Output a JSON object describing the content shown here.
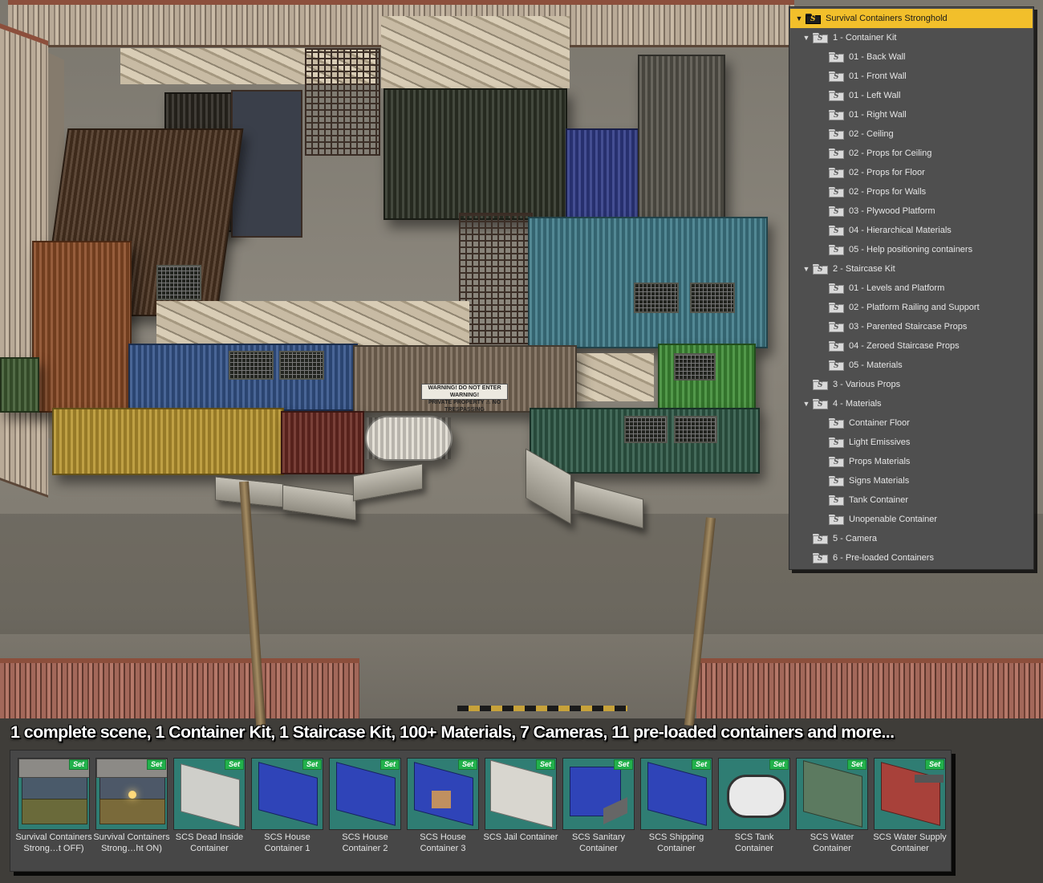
{
  "tree": {
    "root": {
      "label": "Survival Containers Stronghold",
      "expanded": true
    },
    "items": [
      {
        "label": "1 - Container Kit",
        "level": 1,
        "expanded": true
      },
      {
        "label": "01 - Back Wall",
        "level": 2
      },
      {
        "label": "01 - Front Wall",
        "level": 2
      },
      {
        "label": "01 - Left Wall",
        "level": 2
      },
      {
        "label": "01 - Right Wall",
        "level": 2
      },
      {
        "label": "02 - Ceiling",
        "level": 2
      },
      {
        "label": "02 - Props for Ceiling",
        "level": 2
      },
      {
        "label": "02 - Props for Floor",
        "level": 2
      },
      {
        "label": "02 - Props for Walls",
        "level": 2
      },
      {
        "label": "03 - Plywood Platform",
        "level": 2
      },
      {
        "label": "04 - Hierarchical Materials",
        "level": 2
      },
      {
        "label": "05 - Help positioning containers",
        "level": 2
      },
      {
        "label": "2 - Staircase Kit",
        "level": 1,
        "expanded": true
      },
      {
        "label": "01 - Levels and Platform",
        "level": 2
      },
      {
        "label": "02 - Platform Railing and Support",
        "level": 2
      },
      {
        "label": "03 - Parented Staircase Props",
        "level": 2
      },
      {
        "label": "04 - Zeroed Staircase Props",
        "level": 2
      },
      {
        "label": "05 - Materials",
        "level": 2
      },
      {
        "label": "3 - Various Props",
        "level": 1
      },
      {
        "label": "4 - Materials",
        "level": 1,
        "expanded": true
      },
      {
        "label": "Container Floor",
        "level": 2
      },
      {
        "label": "Light Emissives",
        "level": 2
      },
      {
        "label": "Props Materials",
        "level": 2
      },
      {
        "label": "Signs Materials",
        "level": 2
      },
      {
        "label": "Tank Container",
        "level": 2
      },
      {
        "label": "Unopenable Container",
        "level": 2
      },
      {
        "label": "5 - Camera",
        "level": 1
      },
      {
        "label": "6 - Pre-loaded Containers",
        "level": 1
      }
    ]
  },
  "caption": "1 complete scene, 1 Container Kit, 1 Staircase Kit, 100+ Materials, 7 Cameras, 11 pre-loaded containers and more...",
  "scene_sign": {
    "line1": "WARNING!   DO NOT ENTER   WARNING!",
    "line2": "PRIVATE PROPERTY ⚠ NO TRESPASSING"
  },
  "thumbnails": [
    {
      "label": "Survival Containers Strong…t OFF)",
      "badge": "Set",
      "kind": "scene"
    },
    {
      "label": "Survival Containers Strong…ht ON)",
      "badge": "Set",
      "kind": "scene-lit"
    },
    {
      "label": "SCS Dead Inside Container",
      "badge": "Set",
      "kind": "white"
    },
    {
      "label": "SCS House Container 1",
      "badge": "Set",
      "kind": "blue"
    },
    {
      "label": "SCS House Container 2",
      "badge": "Set",
      "kind": "blue"
    },
    {
      "label": "SCS House Container 3",
      "badge": "Set",
      "kind": "blue-open"
    },
    {
      "label": "SCS Jail Container",
      "badge": "Set",
      "kind": "jail"
    },
    {
      "label": "SCS Sanitary Container",
      "badge": "Set",
      "kind": "sanitary"
    },
    {
      "label": "SCS Shipping Container",
      "badge": "Set",
      "kind": "blue"
    },
    {
      "label": "SCS Tank Container",
      "badge": "Set",
      "kind": "tank"
    },
    {
      "label": "SCS Water Container",
      "badge": "Set",
      "kind": "green"
    },
    {
      "label": "SCS Water Supply Container",
      "badge": "Set",
      "kind": "red"
    }
  ],
  "colors": {
    "tree_bg": "#4f4f4f",
    "tree_selected": "#f2bf2b",
    "badge_green": "#22b14c",
    "thumb_bg": "#2f7d73"
  },
  "icons": [
    "folder-icon",
    "expand-arrow-icon"
  ]
}
